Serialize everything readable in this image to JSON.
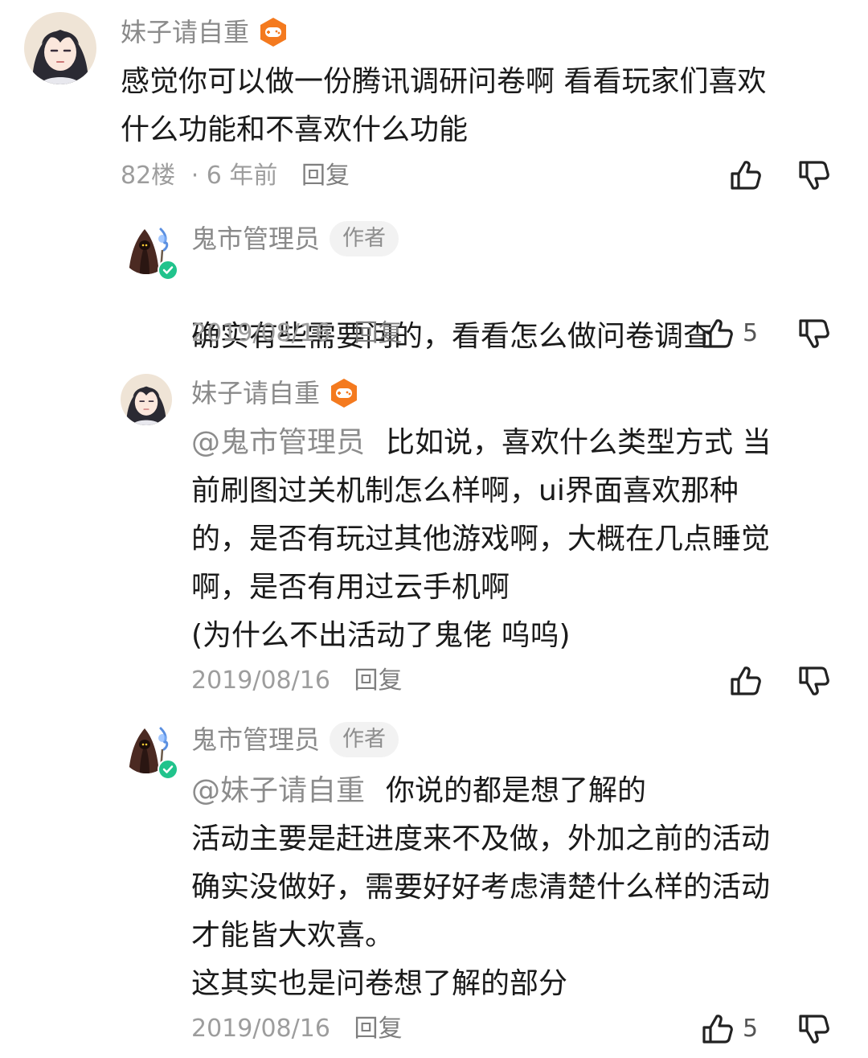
{
  "comments": [
    {
      "user": "妹子请自重",
      "text": "感觉你可以做一份腾讯调研问卷啊 看看玩家们喜欢\n什么功能和不喜欢什么功能",
      "floor": "82楼",
      "time": "· 6 年前",
      "reply": "回复",
      "like_count": ""
    },
    {
      "user": "鬼市管理员",
      "tag": "作者",
      "text": "确实有些需要问的，看看怎么做问卷调查",
      "time": "2019/08/16",
      "reply": "回复",
      "like_count": "5"
    },
    {
      "user": "妹子请自重",
      "mention": "@鬼市管理员",
      "text": "比如说，喜欢什么类型方式 当\n前刷图过关机制怎么样啊，ui界面喜欢那种\n的，是否有玩过其他游戏啊，大概在几点睡觉\n啊，是否有用过云手机啊\n(为什么不出活动了鬼佬 呜呜)",
      "time": "2019/08/16",
      "reply": "回复",
      "like_count": ""
    },
    {
      "user": "鬼市管理员",
      "tag": "作者",
      "mention": "@妹子请自重",
      "text": "你说的都是想了解的\n活动主要是赶进度来不及做，外加之前的活动\n确实没做好，需要好好考虑清楚什么样的活动\n才能皆大欢喜。\n这其实也是问卷想了解的部分",
      "time": "2019/08/16",
      "reply": "回复",
      "like_count": "5"
    }
  ],
  "icons": {
    "like": "thumbs-up-icon",
    "dislike": "thumbs-down-icon",
    "badge": "game-controller-badge-icon",
    "verified": "verified-check-icon"
  },
  "colors": {
    "badge_orange": "#f47a1f",
    "verified_green": "#21c38c",
    "meta_gray": "#9d9d9d"
  }
}
